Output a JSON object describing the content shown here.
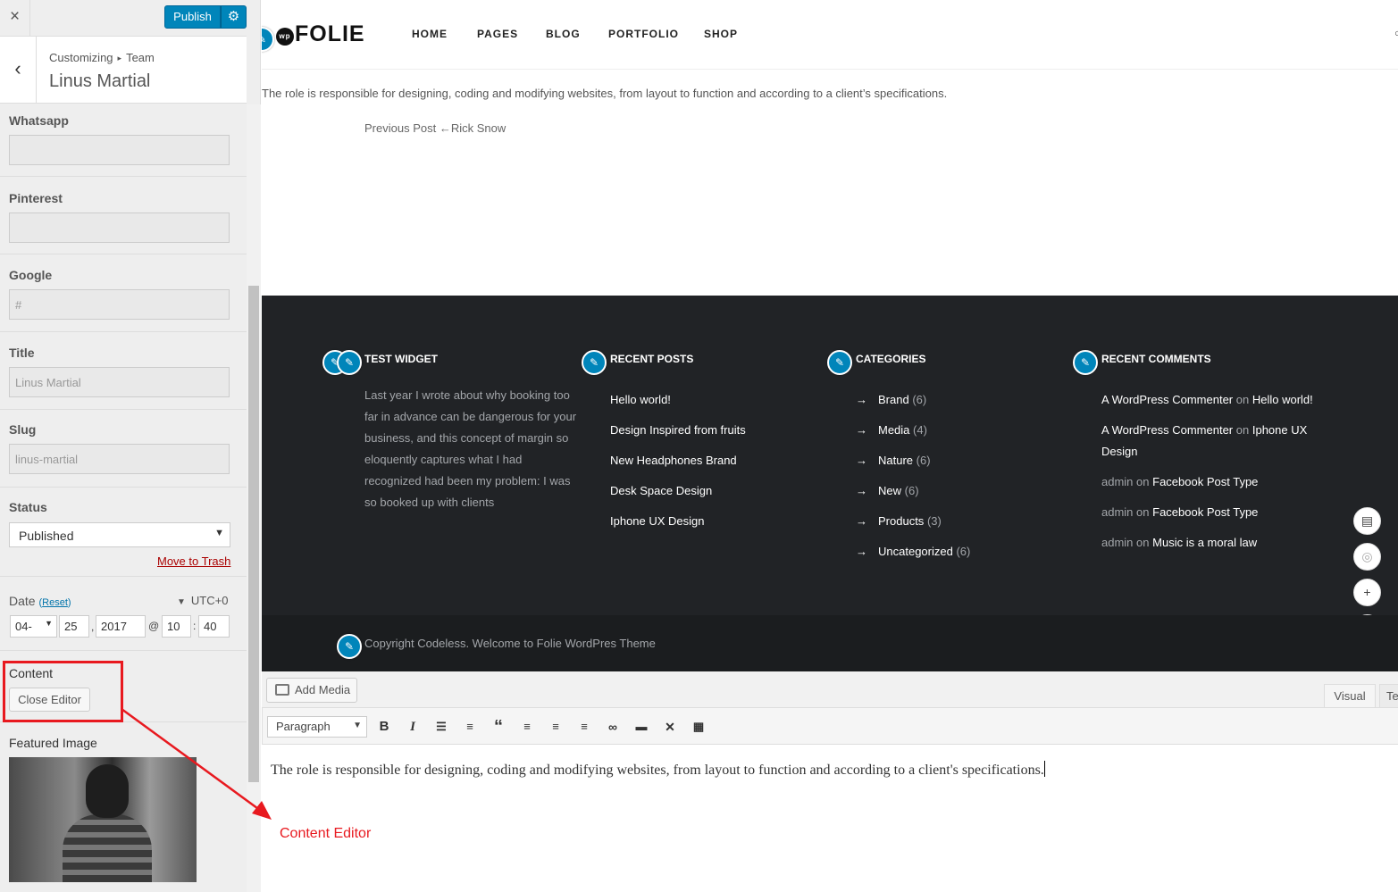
{
  "sidebar": {
    "close_icon": "×",
    "publish_label": "Publish",
    "breadcrumb_root": "Customizing",
    "breadcrumb_sep": "▸",
    "breadcrumb_section": "Team",
    "title": "Linus Martial",
    "fields": {
      "whatsapp": {
        "label": "Whatsapp",
        "value": ""
      },
      "pinterest": {
        "label": "Pinterest",
        "value": ""
      },
      "google": {
        "label": "Google",
        "value": "#"
      },
      "title": {
        "label": "Title",
        "value": "Linus Martial"
      },
      "slug": {
        "label": "Slug",
        "value": "linus-martial"
      }
    },
    "status": {
      "label": "Status",
      "selected": "Published",
      "trash": "Move to Trash"
    },
    "date": {
      "label": "Date",
      "reset": "Reset",
      "tz": "UTC+0",
      "month": "04-",
      "day": "25",
      "year": "2017",
      "at": "@",
      "hour": "10",
      "colon": ":",
      "minute": "40",
      "comma": ","
    },
    "content": {
      "label": "Content",
      "button": "Close Editor"
    },
    "featured": {
      "label": "Featured Image"
    }
  },
  "preview": {
    "logo": "FOLIE",
    "logo_badge": "wp",
    "nav": [
      "HOME",
      "PAGES",
      "BLOG",
      "PORTFOLIO",
      "SHOP"
    ],
    "post_text": "The role is responsible for designing, coding and modifying websites, from layout to function and according to a client’s specifications.",
    "prev_label": "Previous Post",
    "prev_arrow": "←",
    "prev_title": "Rick Snow",
    "footer": {
      "test_widget": {
        "title": "TEST WIDGET",
        "text": "Last year I wrote about why booking too far in advance can be dangerous for your business, and this concept of margin so eloquently captures what I had recognized had been my problem: I was so booked up with clients"
      },
      "recent_posts": {
        "title": "RECENT POSTS",
        "items": [
          "Hello world!",
          "Design Inspired from fruits",
          "New Headphones Brand",
          "Desk Space Design",
          "Iphone UX Design"
        ]
      },
      "categories": {
        "title": "CATEGORIES",
        "items": [
          {
            "name": "Brand",
            "count": "(6)"
          },
          {
            "name": "Media",
            "count": "(4)"
          },
          {
            "name": "Nature",
            "count": "(6)"
          },
          {
            "name": "New",
            "count": "(6)"
          },
          {
            "name": "Products",
            "count": "(3)"
          },
          {
            "name": "Uncategorized",
            "count": "(6)"
          }
        ]
      },
      "recent_comments": {
        "title": "RECENT COMMENTS",
        "on": "on",
        "items": [
          {
            "author": "A WordPress Commenter",
            "post": "Hello world!"
          },
          {
            "author": "A WordPress Commenter",
            "post": "Iphone UX"
          },
          {
            "author": "",
            "post": "Design"
          },
          {
            "author": "admin",
            "post": "Facebook Post Type"
          },
          {
            "author": "admin",
            "post": "Facebook Post Type"
          },
          {
            "author": "admin",
            "post": "Music is a moral law"
          }
        ]
      },
      "copyright": "Copyright Codeless. Welcome to Folie WordPres Theme"
    }
  },
  "editor": {
    "add_media": "Add Media",
    "tab_visual": "Visual",
    "tab_text": "Te",
    "format": "Paragraph",
    "content": "The role is responsible for designing, coding and modifying websites, from layout to function and according to a client's specifications."
  },
  "annotation": {
    "label": "Content Editor",
    "color": "#e8191f"
  },
  "colors": {
    "accent": "#0085ba",
    "footer_bg": "#212326"
  }
}
